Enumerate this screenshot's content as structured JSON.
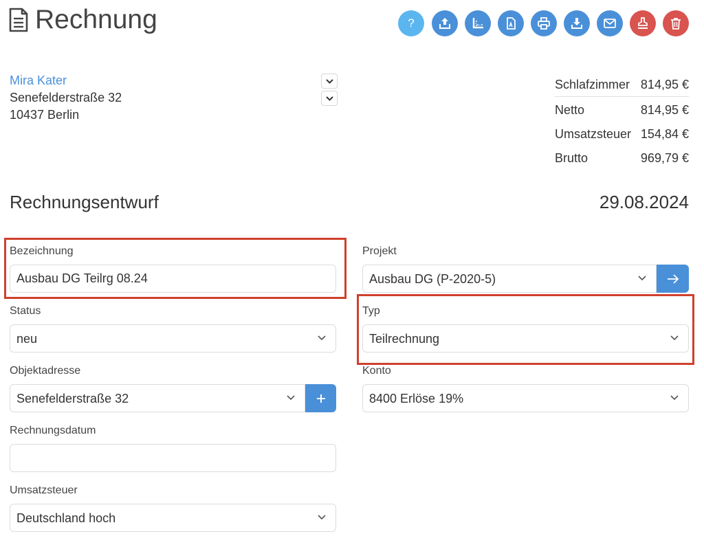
{
  "header": {
    "title": "Rechnung",
    "toolbar": [
      {
        "icon": "question-icon",
        "color": "#5bb6f0",
        "glyph": "?"
      },
      {
        "icon": "upload-icon",
        "color": "#4a90d9"
      },
      {
        "icon": "ruler-icon",
        "color": "#4a90d9"
      },
      {
        "icon": "pdf-icon",
        "color": "#4a90d9"
      },
      {
        "icon": "print-icon",
        "color": "#4a90d9"
      },
      {
        "icon": "download-icon",
        "color": "#4a90d9"
      },
      {
        "icon": "email-icon",
        "color": "#4a90d9"
      },
      {
        "icon": "stamp-icon",
        "color": "#d9534f"
      },
      {
        "icon": "trash-icon",
        "color": "#d9534f"
      }
    ]
  },
  "customer": {
    "name": "Mira Kater",
    "street": "Senefelderstraße 32",
    "city": "10437 Berlin"
  },
  "totals": [
    {
      "label": "Schlafzimmer",
      "value": "814,95 €"
    },
    {
      "label": "Netto",
      "value": "814,95 €"
    },
    {
      "label": "Umsatzsteuer",
      "value": "154,84 €"
    },
    {
      "label": "Brutto",
      "value": "969,79 €"
    }
  ],
  "document": {
    "status_title": "Rechnungsentwurf",
    "date": "29.08.2024"
  },
  "form": {
    "bezeichnung": {
      "label": "Bezeichnung",
      "value": "Ausbau DG Teilrg 08.24"
    },
    "projekt": {
      "label": "Projekt",
      "value": "Ausbau DG (P-2020-5)"
    },
    "status": {
      "label": "Status",
      "value": "neu"
    },
    "typ": {
      "label": "Typ",
      "value": "Teilrechnung"
    },
    "objektadresse": {
      "label": "Objektadresse",
      "value": "Senefelderstraße 32"
    },
    "konto": {
      "label": "Konto",
      "value": "8400 Erlöse 19%"
    },
    "rechnungsdatum": {
      "label": "Rechnungsdatum",
      "value": ""
    },
    "umsatzsteuer": {
      "label": "Umsatzsteuer",
      "value": "Deutschland hoch"
    }
  },
  "colors": {
    "accent": "#4a90d9",
    "danger": "#d9534f",
    "highlight": "#d0402c"
  }
}
